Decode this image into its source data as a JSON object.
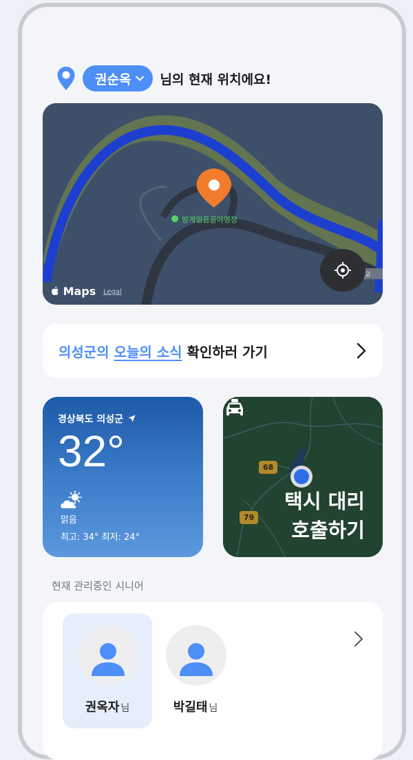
{
  "location_header": {
    "user_name": "권순옥",
    "suffix": "님의 현재 위치에요!"
  },
  "map": {
    "poi_label": "방계얼음골야영장",
    "side_label": "계교",
    "maps_logo": "Maps",
    "legal": "Legal"
  },
  "news": {
    "prefix": "의성군의 ",
    "highlight": "오늘의 소식",
    "suffix": " 확인하러 가기"
  },
  "weather": {
    "region": "경상북도 의성군",
    "temperature": "32°",
    "condition": "맑음",
    "range": "최고: 34° 최저: 24°",
    "icon": "partly-sunny-icon"
  },
  "taxi": {
    "title_line1": "택시 대리",
    "title_line2": "호출하기",
    "road_badge_1": "68",
    "road_badge_2": "79"
  },
  "seniors_section": {
    "label": "현재 관리중인 시니어",
    "items": [
      {
        "name": "권옥자",
        "suffix": "님",
        "selected": true
      },
      {
        "name": "박길태",
        "suffix": "님",
        "selected": false
      }
    ]
  },
  "colors": {
    "accent": "#4d8ef7",
    "weather_top": "#1d5aa8",
    "taxi_bg": "#22432f"
  }
}
